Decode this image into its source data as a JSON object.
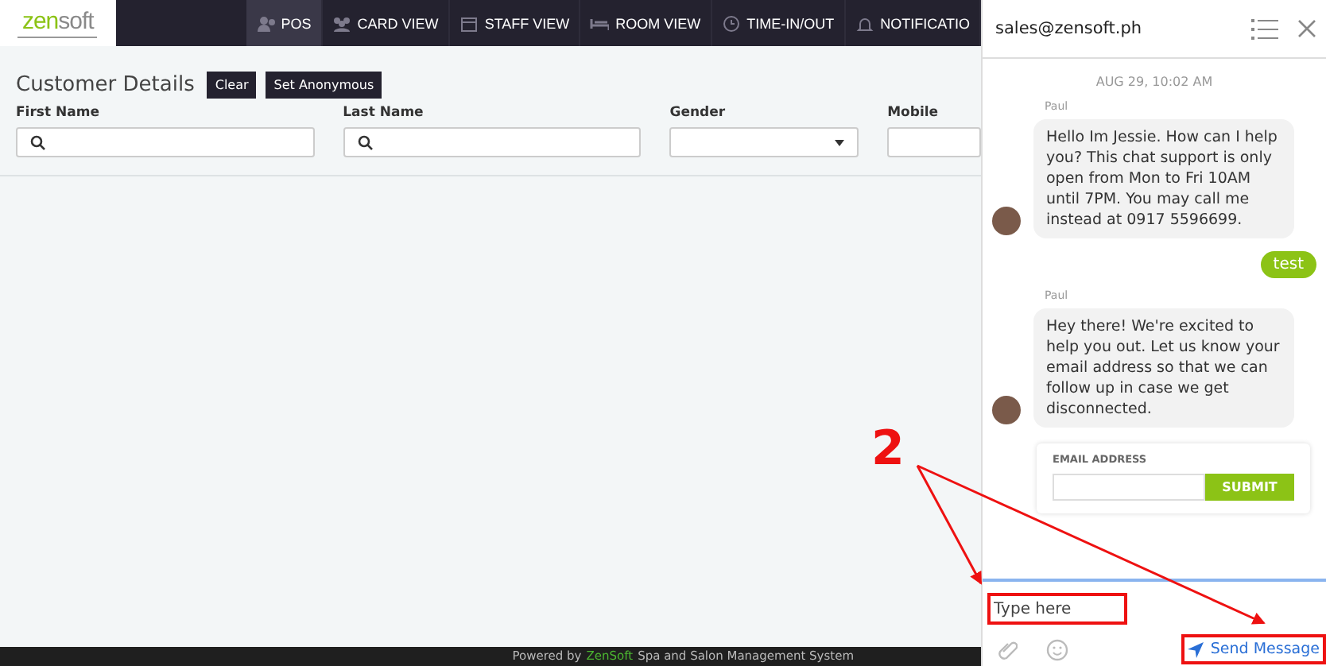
{
  "logo": {
    "name": "zensoft"
  },
  "nav": [
    {
      "label": "POS",
      "selected": true
    },
    {
      "label": "CARD VIEW",
      "selected": false
    },
    {
      "label": "STAFF VIEW",
      "selected": false
    },
    {
      "label": "ROOM VIEW",
      "selected": false
    },
    {
      "label": "TIME-IN/OUT",
      "selected": false
    },
    {
      "label": "NOTIFICATIO",
      "selected": false
    }
  ],
  "customer": {
    "title": "Customer Details",
    "buttons": [
      "Clear",
      "Set Anonymous"
    ],
    "fields": [
      {
        "label": "First Name",
        "kind": "search"
      },
      {
        "label": "Last Name",
        "kind": "search"
      },
      {
        "label": "Gender",
        "kind": "select"
      },
      {
        "label": "Mobile",
        "kind": "text"
      }
    ]
  },
  "footer": {
    "prefix": "Powered by",
    "brand": "ZenSoft",
    "suffix": "Spa and Salon Management System"
  },
  "chat": {
    "title": "sales@zensoft.ph",
    "date": "AUG 29, 10:02 AM",
    "messages": [
      {
        "kind": "agent",
        "sender": "Paul",
        "text": "Hello Im Jessie. How can I help you? This chat support is only open from Mon to Fri 10AM until 7PM. You may call me instead at 0917 5596699."
      },
      {
        "kind": "visitor",
        "text": "test"
      },
      {
        "kind": "agent",
        "sender": "Paul",
        "text": "Hey there! We're excited to help you out. Let us know your email address so that we can follow up in case we get disconnected."
      }
    ],
    "email_form": {
      "label": "EMAIL ADDRESS",
      "button": "SUBMIT"
    },
    "input": {
      "placeholder": "Type here"
    },
    "send": "Send Message"
  },
  "annotation": {
    "label": "2"
  }
}
